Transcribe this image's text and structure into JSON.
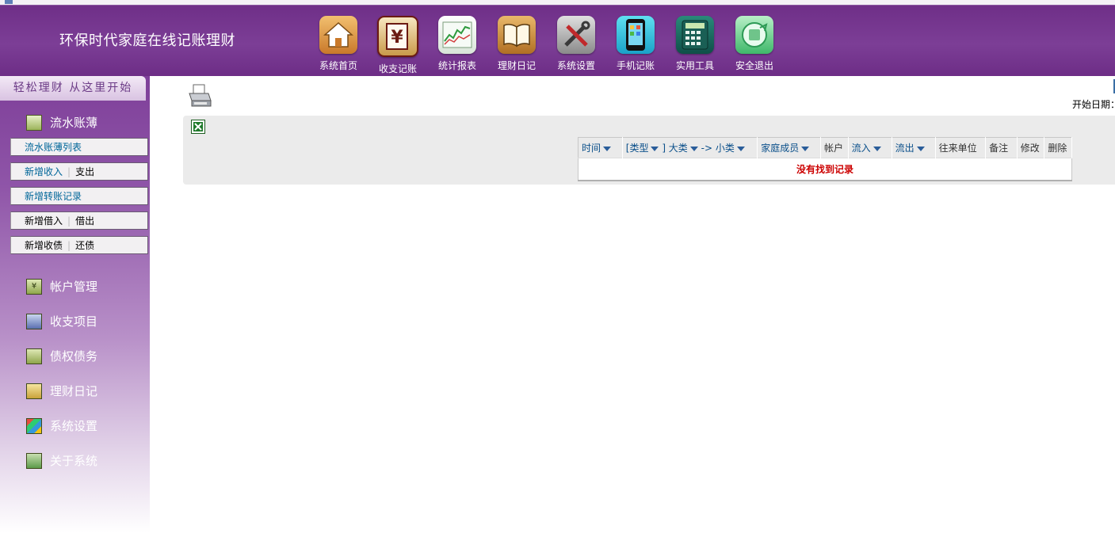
{
  "header": {
    "title": "环保时代家庭在线记账理财",
    "nav": [
      {
        "label": "系统首页",
        "icon": "home-icon"
      },
      {
        "label": "收支记账",
        "icon": "yen-ledger-icon"
      },
      {
        "label": "统计报表",
        "icon": "chart-report-icon"
      },
      {
        "label": "理财日记",
        "icon": "book-icon"
      },
      {
        "label": "系统设置",
        "icon": "tools-icon"
      },
      {
        "label": "手机记账",
        "icon": "mobile-phone-icon"
      },
      {
        "label": "实用工具",
        "icon": "calculator-icon"
      },
      {
        "label": "安全退出",
        "icon": "exit-icon"
      }
    ]
  },
  "sidebar": {
    "slogan": "轻松理财 从这里开始",
    "section": {
      "label": "流水账薄",
      "icon": "ledger-icon"
    },
    "subitems": [
      {
        "a": "流水账薄列表"
      },
      {
        "a": "新增收入",
        "b": "支出"
      },
      {
        "a": "新增转账记录"
      },
      {
        "a": "新增借入",
        "b": "借出"
      },
      {
        "a": "新增收债",
        "b": "还债"
      }
    ],
    "menu": [
      {
        "label": "帐户管理",
        "icon": "account-icon"
      },
      {
        "label": "收支项目",
        "icon": "items-icon"
      },
      {
        "label": "债权债务",
        "icon": "debt-icon"
      },
      {
        "label": "理财日记",
        "icon": "diary-icon"
      },
      {
        "label": "系统设置",
        "icon": "windows-settings-icon"
      },
      {
        "label": "关于系统",
        "icon": "about-icon"
      }
    ]
  },
  "main": {
    "start_date_label": "开始日期：",
    "table": {
      "headers": [
        {
          "text": "时间",
          "sortable": true
        },
        {
          "text": "[类型",
          "sortable": true
        },
        {
          "text": "] 大类",
          "sortable": true
        },
        {
          "text": "-> 小类",
          "sortable": true
        },
        {
          "text": "家庭成员",
          "sortable": true
        },
        {
          "text": "帐户",
          "sortable": false
        },
        {
          "text": "流入",
          "sortable": true
        },
        {
          "text": "流出",
          "sortable": true
        },
        {
          "text": "往来单位",
          "sortable": false
        },
        {
          "text": "备注",
          "sortable": false
        },
        {
          "text": "修改",
          "sortable": false
        },
        {
          "text": "删除",
          "sortable": false
        }
      ],
      "empty_message": "没有找到记录"
    }
  },
  "colors": {
    "header_bg": "#7c3e96",
    "link": "#006699",
    "empty_text": "#cc0000"
  }
}
